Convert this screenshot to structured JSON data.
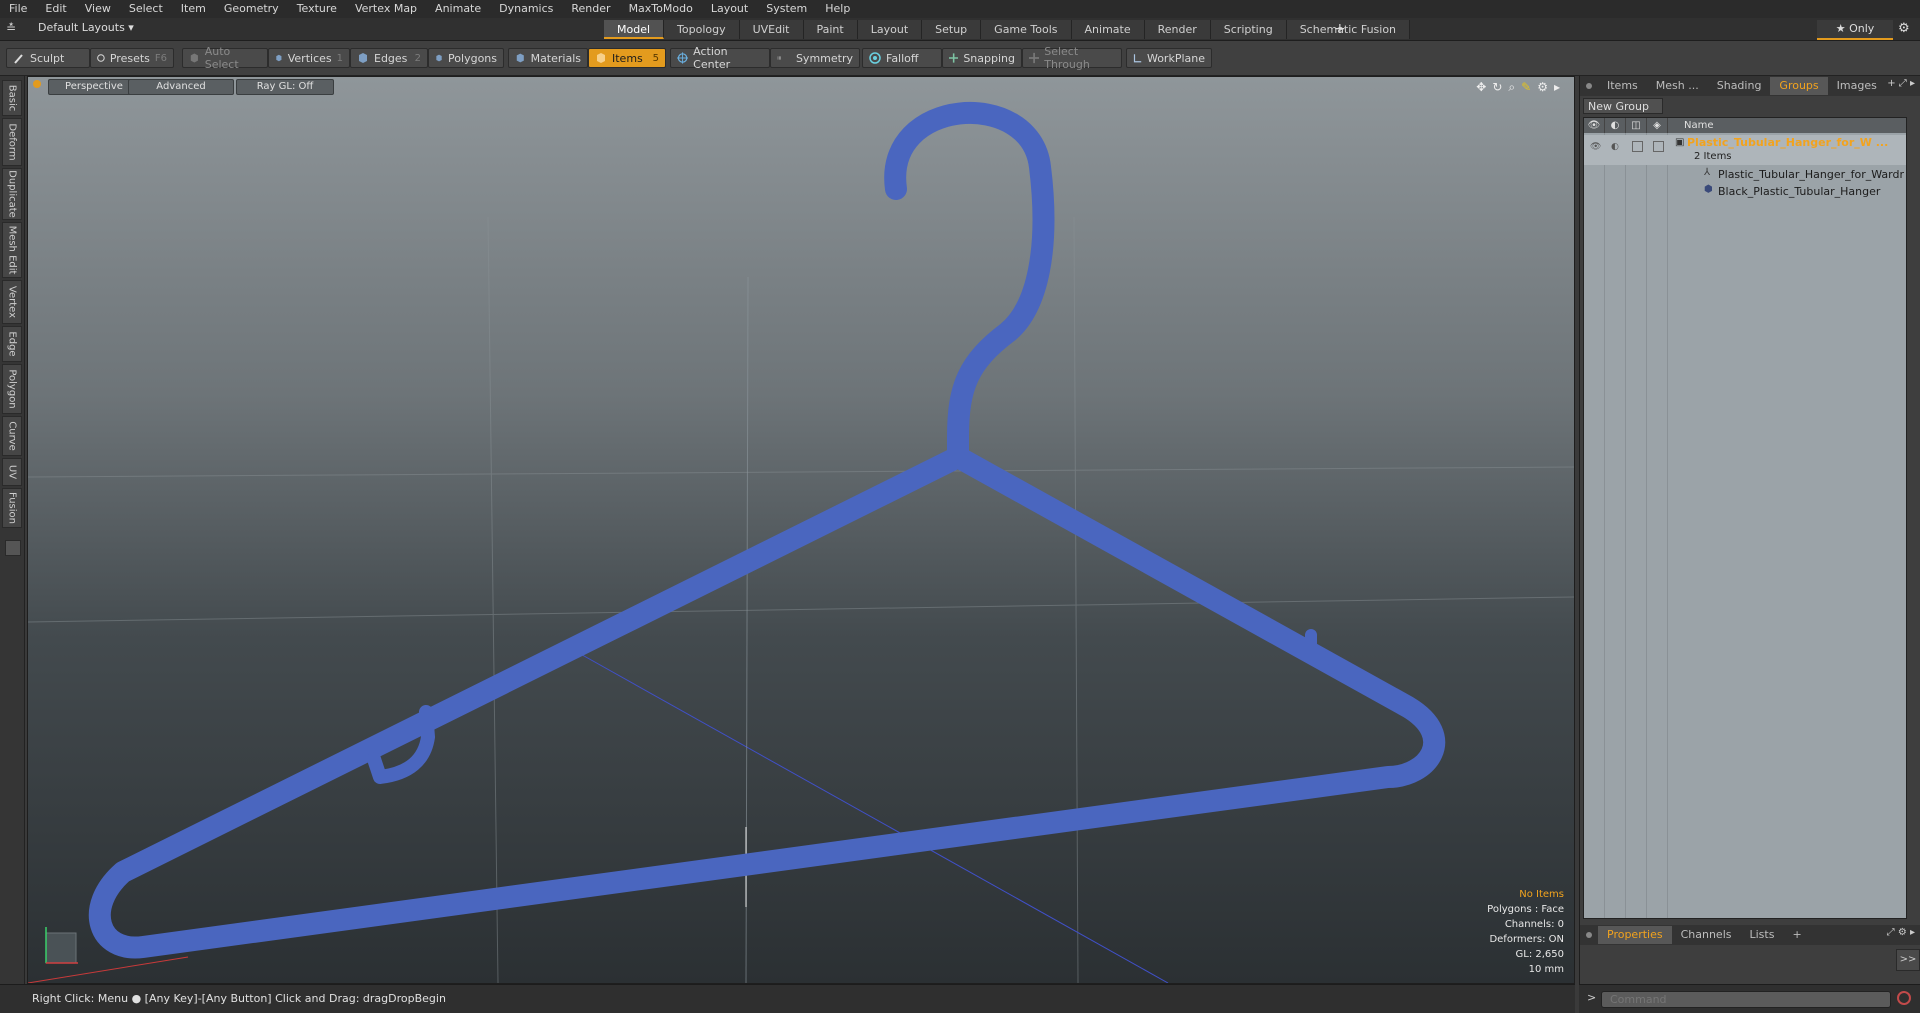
{
  "menu": [
    "File",
    "Edit",
    "View",
    "Select",
    "Item",
    "Geometry",
    "Texture",
    "Vertex Map",
    "Animate",
    "Dynamics",
    "Render",
    "MaxToModo",
    "Layout",
    "System",
    "Help"
  ],
  "layoutbar": {
    "layout_dropdown": "Default Layouts ▾",
    "tabs": [
      "Model",
      "Topology",
      "UVEdit",
      "Paint",
      "Layout",
      "Setup",
      "Game Tools",
      "Animate",
      "Render",
      "Scripting",
      "Schematic Fusion"
    ],
    "active_tab": "Model",
    "add_tab": "+",
    "only_label": "★  Only",
    "gear": "⚙"
  },
  "toolbar": {
    "sculpt": "Sculpt",
    "presets": "Presets",
    "presets_key": "F6",
    "auto_select": "Auto Select",
    "vertices": "Vertices",
    "vertices_key": "1",
    "edges": "Edges",
    "edges_key": "2",
    "polygons": "Polygons",
    "materials": "Materials",
    "items": "Items",
    "items_key": "5",
    "action_center": "Action Center",
    "symmetry": "Symmetry",
    "falloff": "Falloff",
    "snapping": "Snapping",
    "select_through": "Select Through",
    "workplane": "WorkPlane"
  },
  "lefttabs": [
    "Basic",
    "Deform",
    "Duplicate",
    "Mesh Edit",
    "Vertex",
    "Edge",
    "Polygon",
    "Curve",
    "UV",
    "Fusion"
  ],
  "viewport": {
    "view_mode": "Perspective",
    "shading": "Advanced",
    "raygl": "Ray GL: Off",
    "info": {
      "selection": "No Items",
      "polygons": "Polygons : Face",
      "channels": "Channels: 0",
      "deformers": "Deformers: ON",
      "gl": "GL: 2,650",
      "scale": "10 mm"
    },
    "hanger_color": "#4a66bf"
  },
  "rightpanel": {
    "tabs": [
      "Items",
      "Mesh ...",
      "Shading",
      "Groups",
      "Images"
    ],
    "active_tab": "Groups",
    "new_group": "New Group",
    "name_header": "Name",
    "group_name": "Plastic_Tubular_Hanger_for_W ...",
    "group_count": "2 Items",
    "children": [
      "Plastic_Tubular_Hanger_for_Wardr...",
      "Black_Plastic_Tubular_Hanger"
    ],
    "bottom_tabs": [
      "Properties",
      "Channels",
      "Lists"
    ],
    "bottom_active": "Properties",
    "expand": ">>"
  },
  "statusbar": {
    "text": "Right Click: Menu ●  [Any Key]-[Any Button] Click and Drag: dragDropBegin"
  },
  "command": {
    "placeholder": "Command"
  },
  "colors": {
    "accent": "#e39b1e",
    "hanger": "#4a66bf"
  }
}
